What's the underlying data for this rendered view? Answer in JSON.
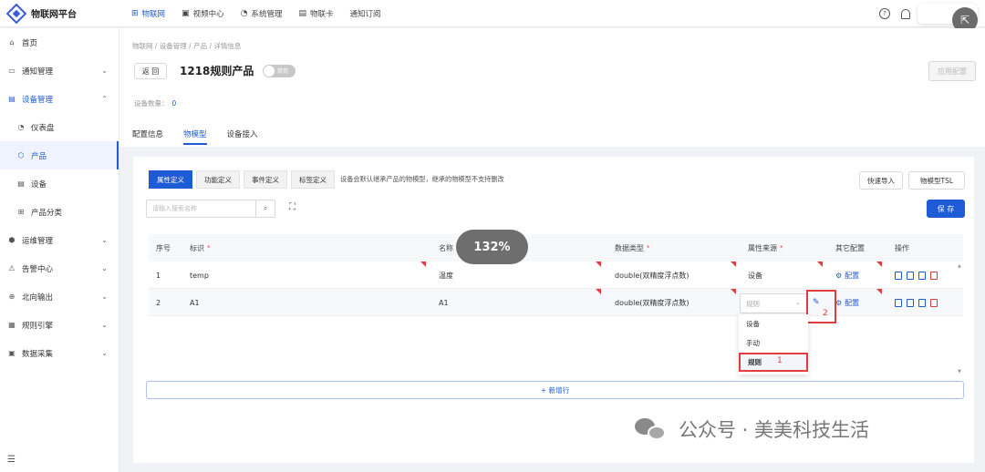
{
  "brand": {
    "name": "物联网平台"
  },
  "topnav": [
    {
      "icon": "iot-icon",
      "label": "物联网",
      "active": true
    },
    {
      "icon": "video-icon",
      "label": "视频中心",
      "active": false
    },
    {
      "icon": "settings-icon",
      "label": "系统管理",
      "active": false
    },
    {
      "icon": "card-icon",
      "label": "物联卡",
      "active": false
    },
    {
      "icon": "",
      "label": "通知订阅",
      "active": false
    }
  ],
  "sidebar": {
    "items": [
      {
        "label": "首页",
        "icon": "home-icon"
      },
      {
        "label": "通知管理",
        "icon": "notice-icon"
      },
      {
        "label": "设备管理",
        "icon": "device-mgmt-icon"
      },
      {
        "label": "仪表盘",
        "icon": "dashboard-icon"
      },
      {
        "label": "产品",
        "icon": "product-icon"
      },
      {
        "label": "设备",
        "icon": "device-icon"
      },
      {
        "label": "产品分类",
        "icon": "category-icon"
      },
      {
        "label": "运维管理",
        "icon": "ops-icon"
      },
      {
        "label": "告警中心",
        "icon": "alarm-icon"
      },
      {
        "label": "北向输出",
        "icon": "northbound-icon"
      },
      {
        "label": "规则引擎",
        "icon": "rule-engine-icon"
      },
      {
        "label": "数据采集",
        "icon": "data-collect-icon"
      }
    ]
  },
  "header": {
    "breadcrumb": "物联网 / 设备管理 / 产品 / 详情信息",
    "back_label": "返 回",
    "title": "1218规则产品",
    "toggle_label": "禁用",
    "toggle_on": false,
    "apply_label": "应用配置",
    "device_count_label": "设备数量：",
    "device_count": "0",
    "tabs": [
      "配置信息",
      "物模型",
      "设备接入"
    ]
  },
  "model": {
    "subtabs": [
      "属性定义",
      "功能定义",
      "事件定义",
      "标签定义"
    ],
    "note": "设备会默认继承产品的物模型，继承的物模型不支持删改",
    "quick_import": "快速导入",
    "tsl": "物模型TSL",
    "search_placeholder": "请输入搜索名称",
    "save": "保 存",
    "columns": [
      "序号",
      "标识",
      "名称",
      "数据类型",
      "属性来源",
      "其它配置",
      "操作"
    ],
    "rows": [
      {
        "no": "1",
        "id": "temp",
        "name": "温度",
        "type": "double(双精度浮点数)",
        "source": "设备",
        "config": "配置"
      },
      {
        "no": "2",
        "id": "A1",
        "name": "A1",
        "type": "double(双精度浮点数)",
        "source": "",
        "config": "配置"
      }
    ],
    "source_select_value": "规则",
    "dropdown_options": [
      "设备",
      "手动",
      "规则"
    ],
    "markers": [
      "1",
      "2"
    ],
    "add_row": "+ 新增行"
  },
  "zoom": "132%",
  "watermark": "公众号 · 美美科技生活",
  "colors": {
    "accent": "#1e5bd6",
    "danger": "#e23c3c"
  }
}
